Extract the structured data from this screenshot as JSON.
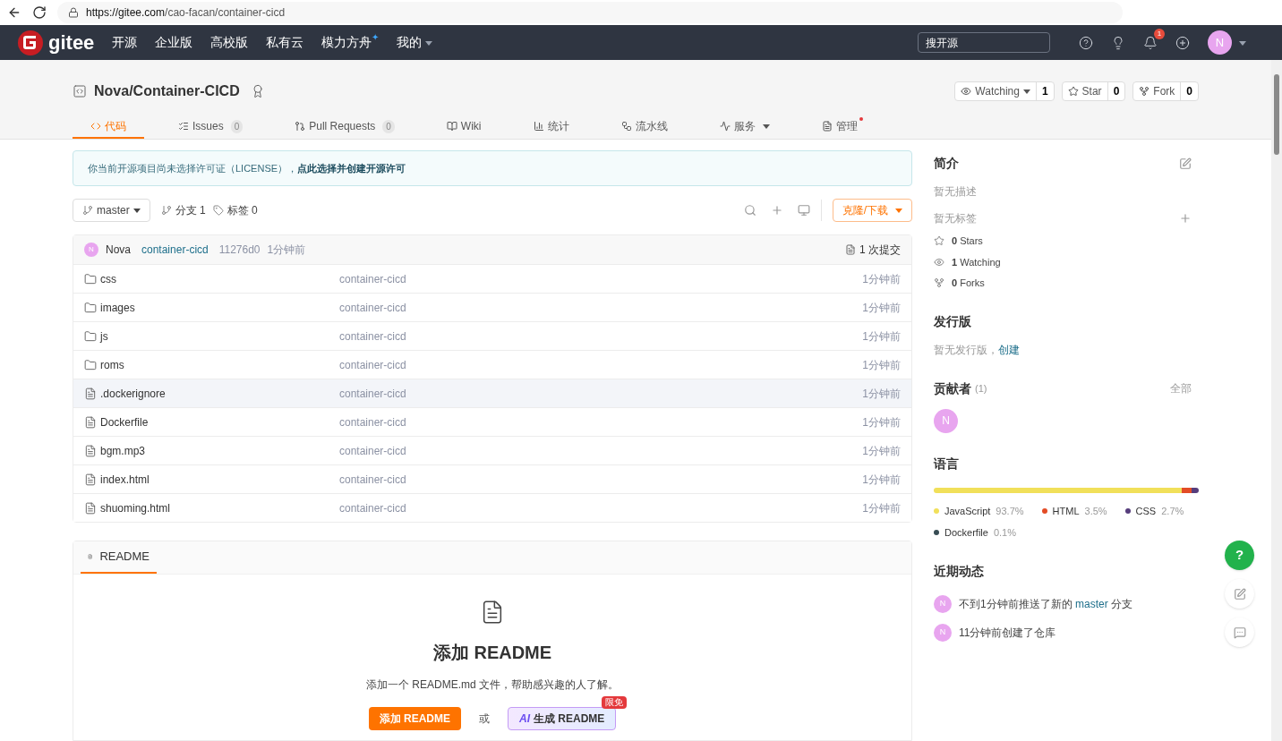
{
  "browser": {
    "url_host": "https://gitee.com",
    "url_path": "/cao-facan/container-cicd"
  },
  "nav": {
    "logo": "gitee",
    "items": [
      {
        "label": "开源",
        "dropdown": false
      },
      {
        "label": "企业版",
        "dropdown": false
      },
      {
        "label": "高校版",
        "dropdown": false
      },
      {
        "label": "私有云",
        "dropdown": false
      },
      {
        "label": "模力方舟",
        "sparkle": "✦",
        "dropdown": false
      },
      {
        "label": "我的",
        "dropdown": true
      }
    ],
    "search_placeholder": "搜开源",
    "notification_count": "1",
    "avatar": "N"
  },
  "repo": {
    "title": "Nova/Container-CICD",
    "actions": [
      {
        "label": "Watching",
        "count": "1",
        "dropdown": true
      },
      {
        "label": "Star",
        "count": "0",
        "dropdown": false
      },
      {
        "label": "Fork",
        "count": "0",
        "dropdown": false
      }
    ],
    "tabs": [
      {
        "label": "代码",
        "selected": true,
        "dropdown": false,
        "dot": false
      },
      {
        "label": "Issues",
        "count": "0",
        "selected": false,
        "dropdown": false,
        "dot": false
      },
      {
        "label": "Pull Requests",
        "count": "0",
        "selected": false,
        "dropdown": false,
        "dot": false
      },
      {
        "label": "Wiki",
        "selected": false,
        "dropdown": false,
        "dot": false
      },
      {
        "label": "统计",
        "selected": false,
        "dropdown": false,
        "dot": false
      },
      {
        "label": "流水线",
        "selected": false,
        "dropdown": false,
        "dot": false
      },
      {
        "label": "服务",
        "selected": false,
        "dropdown": true,
        "dot": false
      },
      {
        "label": "管理",
        "selected": false,
        "dropdown": false,
        "dot": true
      }
    ]
  },
  "notice": {
    "text": "你当前开源项目尚未选择许可证（LICENSE），",
    "link": "点此选择并创建开源许可"
  },
  "toolbar": {
    "branch": "master",
    "branches": "分支 1",
    "tags": "标签 0",
    "clone": "克隆/下载"
  },
  "commit": {
    "avatar": "N",
    "author": "Nova",
    "message": "container-cicd",
    "hash": "11276d0",
    "time": "1分钟前",
    "commits": "1 次提交"
  },
  "files": [
    {
      "kind": "folder",
      "name": "css",
      "message": "container-cicd",
      "time": "1分钟前",
      "highlighted": false
    },
    {
      "kind": "folder",
      "name": "images",
      "message": "container-cicd",
      "time": "1分钟前",
      "highlighted": false
    },
    {
      "kind": "folder",
      "name": "js",
      "message": "container-cicd",
      "time": "1分钟前",
      "highlighted": false
    },
    {
      "kind": "folder",
      "name": "roms",
      "message": "container-cicd",
      "time": "1分钟前",
      "highlighted": false
    },
    {
      "kind": "file",
      "name": ".dockerignore",
      "message": "container-cicd",
      "time": "1分钟前",
      "highlighted": true
    },
    {
      "kind": "file",
      "name": "Dockerfile",
      "message": "container-cicd",
      "time": "1分钟前",
      "highlighted": false
    },
    {
      "kind": "file",
      "name": "bgm.mp3",
      "message": "container-cicd",
      "time": "1分钟前",
      "highlighted": false
    },
    {
      "kind": "file",
      "name": "index.html",
      "message": "container-cicd",
      "time": "1分钟前",
      "highlighted": false
    },
    {
      "kind": "file",
      "name": "shuoming.html",
      "message": "container-cicd",
      "time": "1分钟前",
      "highlighted": false
    }
  ],
  "readme": {
    "tab": "README",
    "title": "添加 README",
    "description": "添加一个 README.md 文件，帮助感兴趣的人了解。",
    "add_button": "添加 README",
    "or": "或",
    "ai_mark": "AI",
    "ai_button": "生成 README",
    "badge": "限免"
  },
  "sidebar": {
    "intro": {
      "title": "简介",
      "description": "暂无描述",
      "tags": "暂无标签",
      "stats": [
        {
          "count": "0",
          "label": "Stars"
        },
        {
          "count": "1",
          "label": "Watching"
        },
        {
          "count": "0",
          "label": "Forks"
        }
      ]
    },
    "release": {
      "title": "发行版",
      "text": "暂无发行版，",
      "link": "创建"
    },
    "contributors": {
      "title": "贡献者",
      "count": "(1)",
      "all": "全部",
      "avatars": [
        "N"
      ]
    },
    "languages": {
      "title": "语言",
      "items": [
        {
          "name": "JavaScript",
          "percent": "93.7%",
          "color": "#f1e05a"
        },
        {
          "name": "HTML",
          "percent": "3.5%",
          "color": "#e34c26"
        },
        {
          "name": "CSS",
          "percent": "2.7%",
          "color": "#563d7c"
        },
        {
          "name": "Dockerfile",
          "percent": "0.1%",
          "color": "#384d54"
        }
      ]
    },
    "activity": {
      "title": "近期动态",
      "items": [
        {
          "avatar": "N",
          "before": "不到1分钟前推送了新的 ",
          "link": "master",
          "after": " 分支"
        },
        {
          "avatar": "N",
          "before": "11分钟前创建了仓库"
        }
      ]
    }
  },
  "float": {
    "help": "?"
  }
}
